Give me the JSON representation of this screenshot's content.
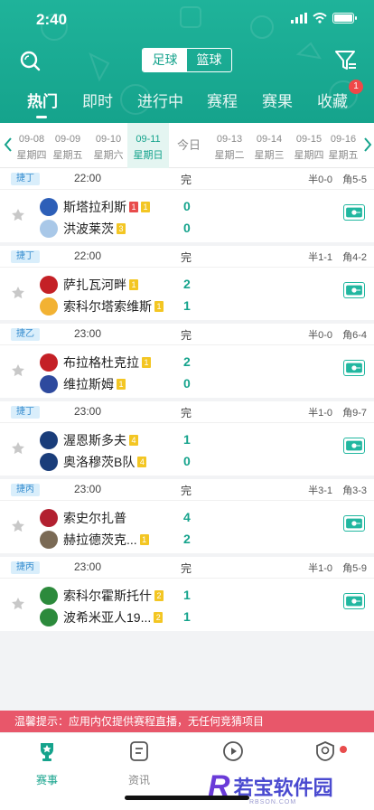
{
  "status_bar": {
    "time": "2:40"
  },
  "header": {
    "sport_tabs": [
      "足球",
      "篮球"
    ],
    "tabs": [
      "热门",
      "即时",
      "进行中",
      "赛程",
      "赛果",
      "收藏"
    ],
    "favorites_badge": "1"
  },
  "dates": [
    {
      "d1": "09-08",
      "d2": "星期四"
    },
    {
      "d1": "09-09",
      "d2": "星期五"
    },
    {
      "d1": "09-10",
      "d2": "星期六"
    },
    {
      "d1": "09-11",
      "d2": "星期日"
    },
    {
      "d1": "今日",
      "d2": ""
    },
    {
      "d1": "09-13",
      "d2": "星期二"
    },
    {
      "d1": "09-14",
      "d2": "星期三"
    },
    {
      "d1": "09-15",
      "d2": "星期四"
    },
    {
      "d1": "09-16",
      "d2": "星期五"
    }
  ],
  "matches": [
    {
      "league": "捷丁",
      "time": "22:00",
      "status": "完",
      "half": "半0-0",
      "corner": "角5-5",
      "home": {
        "name": "斯塔拉利斯",
        "chips": [
          {
            "t": "1",
            "c": "red"
          },
          {
            "t": "1",
            "c": "yellow"
          }
        ],
        "score": "0"
      },
      "away": {
        "name": "洪波莱茨",
        "chips": [
          {
            "t": "3",
            "c": "yellow"
          }
        ],
        "score": "0"
      }
    },
    {
      "league": "捷丁",
      "time": "22:00",
      "status": "完",
      "half": "半1-1",
      "corner": "角4-2",
      "home": {
        "name": "萨扎瓦河畔",
        "chips": [
          {
            "t": "1",
            "c": "yellow"
          }
        ],
        "score": "2"
      },
      "away": {
        "name": "索科尔塔索维斯",
        "chips": [
          {
            "t": "1",
            "c": "yellow"
          }
        ],
        "score": "1"
      }
    },
    {
      "league": "捷乙",
      "time": "23:00",
      "status": "完",
      "half": "半0-0",
      "corner": "角6-4",
      "home": {
        "name": "布拉格杜克拉",
        "chips": [
          {
            "t": "1",
            "c": "yellow"
          }
        ],
        "score": "2"
      },
      "away": {
        "name": "维拉斯姆",
        "chips": [
          {
            "t": "1",
            "c": "yellow"
          }
        ],
        "score": "0"
      }
    },
    {
      "league": "捷丁",
      "time": "23:00",
      "status": "完",
      "half": "半1-0",
      "corner": "角9-7",
      "home": {
        "name": "渥恩斯多夫",
        "chips": [
          {
            "t": "4",
            "c": "yellow"
          }
        ],
        "score": "1"
      },
      "away": {
        "name": "奥洛穆茨B队",
        "chips": [
          {
            "t": "4",
            "c": "yellow"
          }
        ],
        "score": "0"
      }
    },
    {
      "league": "捷丙",
      "time": "23:00",
      "status": "完",
      "half": "半3-1",
      "corner": "角3-3",
      "home": {
        "name": "索史尔扎普",
        "chips": [],
        "score": "4"
      },
      "away": {
        "name": "赫拉德茨克...",
        "chips": [
          {
            "t": "1",
            "c": "yellow"
          }
        ],
        "score": "2"
      }
    },
    {
      "league": "捷丙",
      "time": "23:00",
      "status": "完",
      "half": "半1-0",
      "corner": "角5-9",
      "home": {
        "name": "索科尔霍斯托什",
        "chips": [
          {
            "t": "2",
            "c": "yellow"
          }
        ],
        "score": "1"
      },
      "away": {
        "name": "波希米亚人19...",
        "chips": [
          {
            "t": "2",
            "c": "yellow"
          }
        ],
        "score": "1"
      }
    }
  ],
  "notice": "温馨提示：应用内仅提供赛程直播，无任何竞猜项目",
  "tabbar": [
    "赛事",
    "资讯",
    "",
    ""
  ],
  "watermark": {
    "mark": "R",
    "text": "若宝软件园",
    "url": "RBSON.COM"
  },
  "colors": {
    "primary": "#15a38c",
    "notice": "#e8576a",
    "badge": "#f04848"
  },
  "icons": [
    "search-icon",
    "filter-icon",
    "star-icon",
    "live-video-icon",
    "trophy-icon",
    "news-icon",
    "play-icon",
    "profile-icon"
  ]
}
